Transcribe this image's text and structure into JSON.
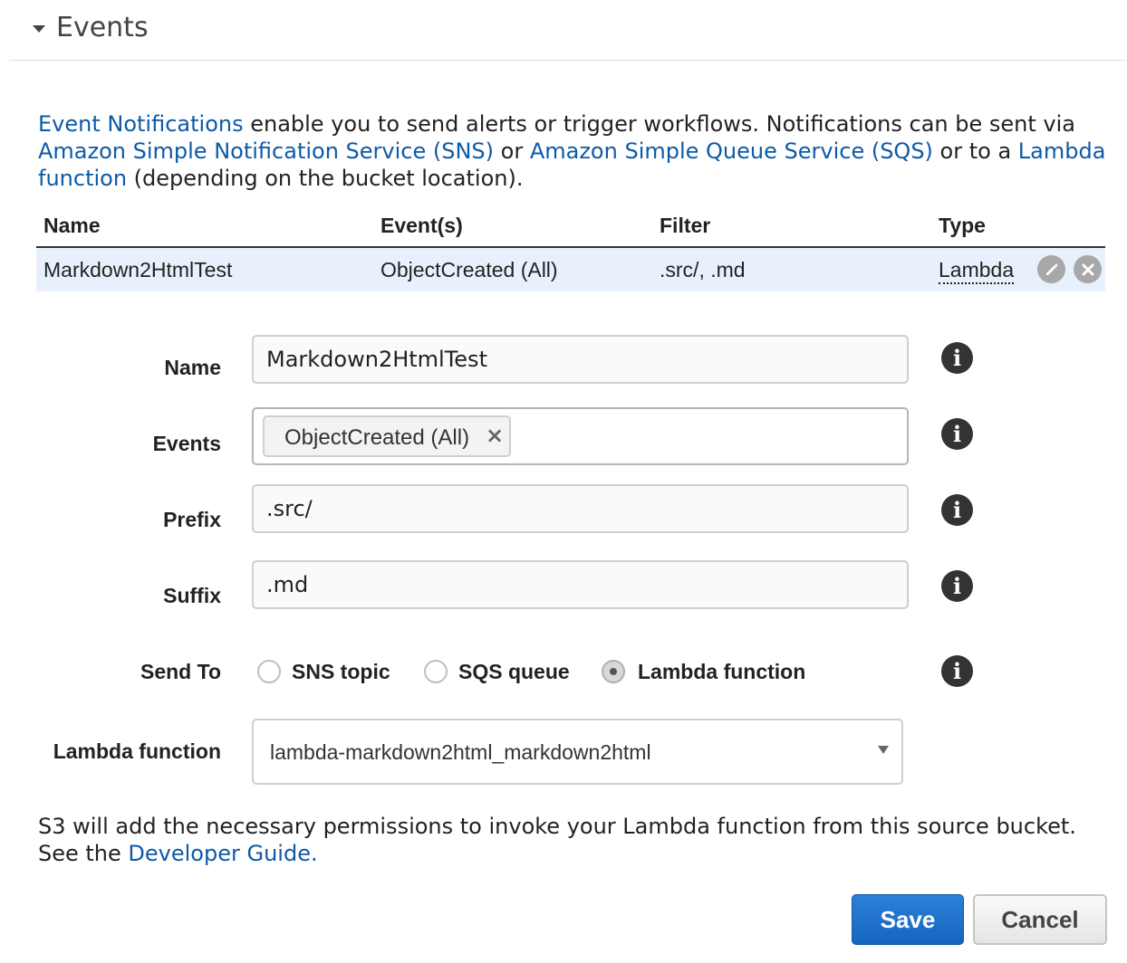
{
  "header": {
    "title": "Events",
    "caret_icon": "caret-down-icon"
  },
  "description": {
    "link1": "Event Notifications",
    "text1": " enable you to send alerts or trigger workflows. Notifications can be sent via ",
    "link2": "Amazon Simple Notification Service (SNS)",
    "text2": " or ",
    "link3": "Amazon Simple Queue Service (SQS)",
    "text3": " or to a ",
    "link4": "Lambda function",
    "text4": " (depending on the bucket location)."
  },
  "table": {
    "columns": [
      "Name",
      "Event(s)",
      "Filter",
      "Type"
    ],
    "rows": [
      {
        "name": "Markdown2HtmlTest",
        "events": "ObjectCreated (All)",
        "filter": ".src/, .md",
        "type": "Lambda"
      }
    ],
    "row_actions": [
      "pencil-icon",
      "close-icon"
    ]
  },
  "form": {
    "name": {
      "label": "Name",
      "value": "Markdown2HtmlTest"
    },
    "events": {
      "label": "Events",
      "tags": [
        "ObjectCreated (All)"
      ]
    },
    "prefix": {
      "label": "Prefix",
      "value": ".src/"
    },
    "suffix": {
      "label": "Suffix",
      "value": ".md"
    },
    "send_to": {
      "label": "Send To",
      "options": [
        "SNS topic",
        "SQS queue",
        "Lambda function"
      ],
      "selected": "Lambda function"
    },
    "lambda_function": {
      "label": "Lambda function",
      "value": "lambda-markdown2html_markdown2html"
    },
    "info_icon": "i"
  },
  "note": {
    "text1": "S3 will add the necessary permissions to invoke your Lambda function from this source bucket.",
    "text2": "See the ",
    "link": "Developer Guide."
  },
  "buttons": {
    "save": "Save",
    "cancel": "Cancel"
  },
  "colors": {
    "link": "#0d5aa8",
    "save_bg": "#1b6fc9",
    "row_highlight": "#e8f1fb"
  }
}
